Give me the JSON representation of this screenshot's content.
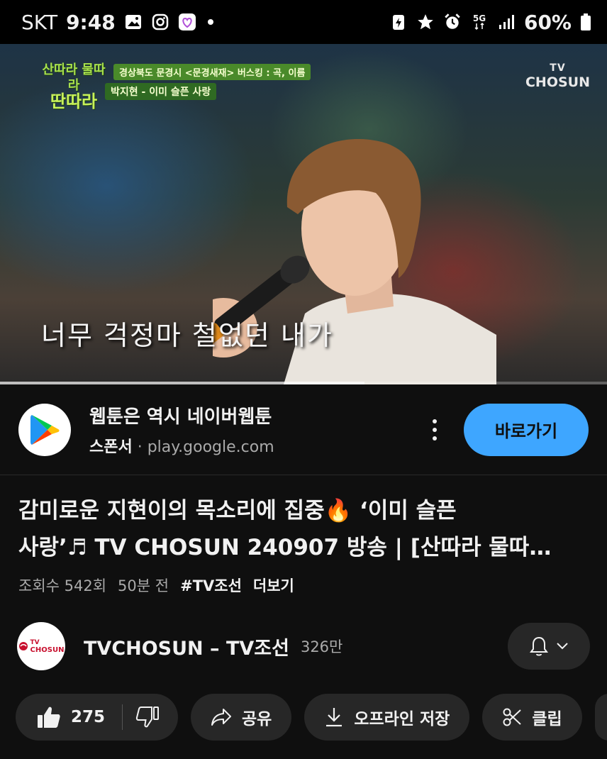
{
  "status_bar": {
    "carrier": "SKT",
    "time": "9:48",
    "network": "5G",
    "battery": "60%"
  },
  "video": {
    "show_logo_line1": "산따라 물따라",
    "show_logo_line2": "딴따라",
    "location_caption": "경상북도 문경시 <문경새재> 버스킹 : 곡, 이름",
    "song_caption": "박지현 - 이미 슬픈 사랑",
    "channel_logo_top": "TV",
    "channel_logo_bottom": "CHOSUN",
    "subtitle": "너무 걱정마 철없던 내가",
    "progress": 0.6
  },
  "ad": {
    "title": "웹툰은 역시 네이버웹툰",
    "sponsor": "스폰서",
    "separator": " · ",
    "domain": "play.google.com",
    "cta": "바로가기"
  },
  "title": "감미로운 지현이의 목소리에 집중🔥 ‘이미 슬픈 사랑’♬ TV CHOSUN 240907 방송 | [산따라 물따…",
  "title_line1": "감미로운 지현이의 목소리에 집중🔥 ‘이미 슬픈",
  "title_line2": "사랑’♬ TV CHOSUN 240907 방송 | [산따라 물따…",
  "meta": {
    "views": "조회수 542회",
    "age": "50분 전",
    "tag": "#TV조선",
    "more": "더보기"
  },
  "channel": {
    "name": "TVCHOSUN – TV조선",
    "subscribers": "326만",
    "avatar_line1": "TV",
    "avatar_line2": "CHOSUN"
  },
  "actions": {
    "likes": "275",
    "share": "공유",
    "download": "오프라인 저장",
    "clip": "클립"
  },
  "colors": {
    "background": "#0f0f0f",
    "chip": "#272727",
    "cta": "#3ea6ff",
    "progress": "#ff0000"
  }
}
